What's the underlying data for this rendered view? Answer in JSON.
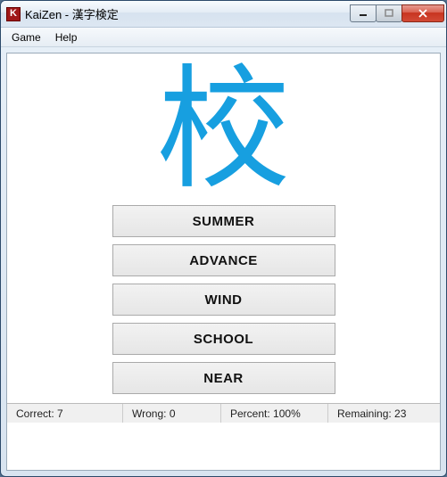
{
  "window": {
    "title": "KaiZen - 漢字検定",
    "icon_letter": "K"
  },
  "menu": {
    "game": "Game",
    "help": "Help"
  },
  "quiz": {
    "kanji": "校",
    "options": [
      "SUMMER",
      "ADVANCE",
      "WIND",
      "SCHOOL",
      "NEAR"
    ]
  },
  "status": {
    "correct_label": "Correct:",
    "correct_value": "7",
    "wrong_label": "Wrong:",
    "wrong_value": "0",
    "percent_label": "Percent:",
    "percent_value": "100%",
    "remaining_label": "Remaining:",
    "remaining_value": "23"
  }
}
